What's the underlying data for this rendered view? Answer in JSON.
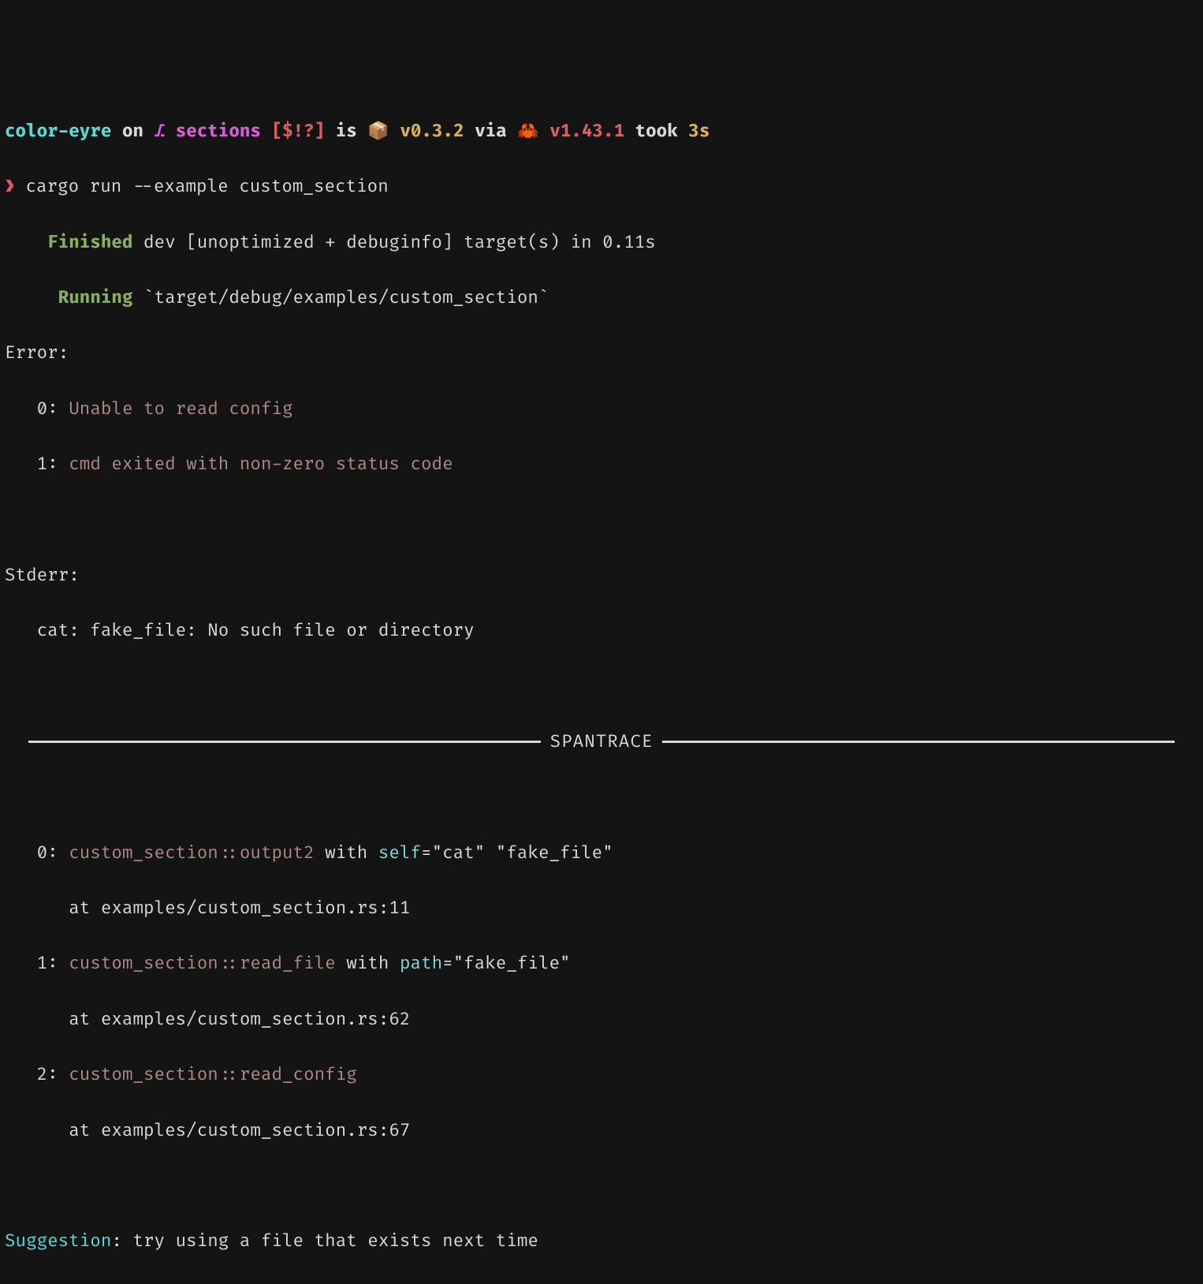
{
  "prompt": {
    "project": "color-eyre",
    "on": "on",
    "branch_icon": "⎇",
    "branch": "sections",
    "git_status": "[$!?]",
    "is": "is",
    "pkg_icon": "📦",
    "pkg_version": "v0.3.2",
    "via": "via",
    "rust_icon": "🦀",
    "rust_version": "v1.43.1",
    "took": "took",
    "duration": "3s",
    "chevron": "❯",
    "command": "cargo run --example custom_section"
  },
  "cargo": {
    "finished_label": "Finished",
    "finished_text": " dev [unoptimized + debuginfo] target(s) in 0.11s",
    "running_label": "Running",
    "running_text": " `target/debug/examples/custom_section`"
  },
  "error_label": "Error:",
  "errors": [
    {
      "idx": "0: ",
      "msg": "Unable to read config"
    },
    {
      "idx": "1: ",
      "msg": "cmd exited with non-zero status code"
    }
  ],
  "stderr_label": "Stderr:",
  "stderr_line": "   cat: fake_file: No such file or directory",
  "spantrace_title": "SPANTRACE",
  "spans": [
    {
      "idx": "0: ",
      "scope": "custom_section::output2",
      "with": " with ",
      "key1": "self",
      "val1": "=\"cat\" \"fake_file\"",
      "at": "      at examples/custom_section.rs:11"
    },
    {
      "idx": "1: ",
      "scope": "custom_section::read_file",
      "with": " with ",
      "key1": "path",
      "val1": "=\"fake_file\"",
      "at": "      at examples/custom_section.rs:62"
    },
    {
      "idx": "2: ",
      "scope": "custom_section::read_config",
      "with": "",
      "key1": "",
      "val1": "",
      "at": "      at examples/custom_section.rs:67"
    }
  ],
  "suggestion_label": "Suggestion",
  "suggestion_text": ": try using a file that exists next time"
}
